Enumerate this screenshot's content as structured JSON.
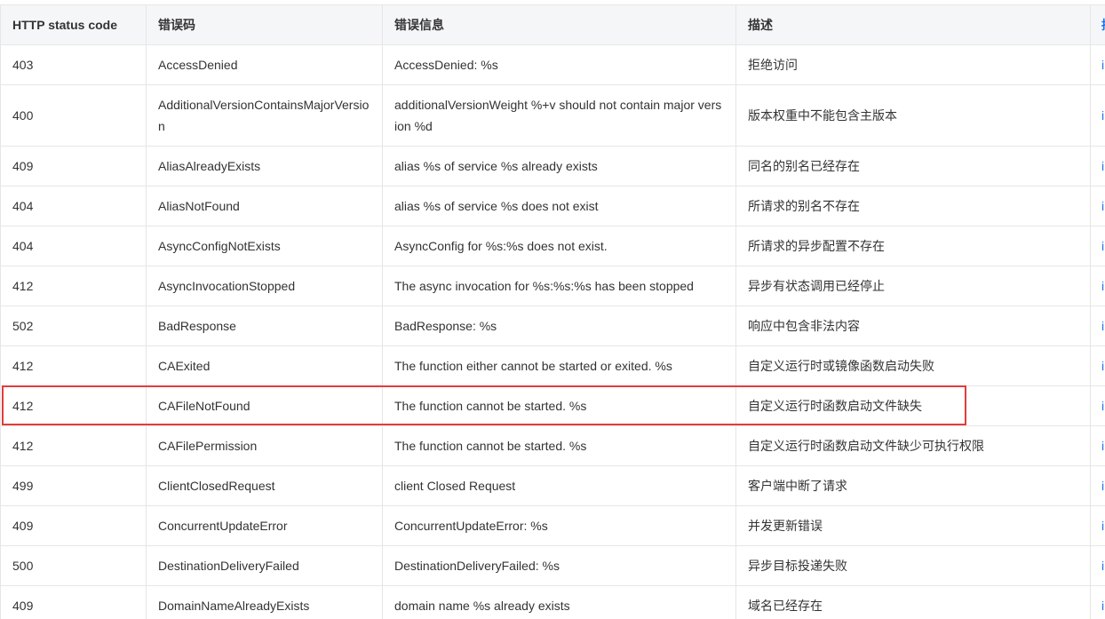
{
  "table": {
    "headers": [
      "HTTP status code",
      "错误码",
      "错误信息",
      "描述",
      "描"
    ],
    "rows": [
      {
        "status": "403",
        "code": "AccessDenied",
        "message": "AccessDenied: %s",
        "desc": "拒绝访问",
        "extra": "i"
      },
      {
        "status": "400",
        "code": "AdditionalVersionContainsMajorVersion",
        "message": "additionalVersionWeight %+v should not contain major version %d",
        "desc": "版本权重中不能包含主版本",
        "extra": "i"
      },
      {
        "status": "409",
        "code": "AliasAlreadyExists",
        "message": "alias %s of service %s already exists",
        "desc": "同名的别名已经存在",
        "extra": "i"
      },
      {
        "status": "404",
        "code": "AliasNotFound",
        "message": "alias %s of service %s does not exist",
        "desc": "所请求的别名不存在",
        "extra": "i"
      },
      {
        "status": "404",
        "code": "AsyncConfigNotExists",
        "message": "AsyncConfig for %s:%s does not exist.",
        "desc": "所请求的异步配置不存在",
        "extra": "i"
      },
      {
        "status": "412",
        "code": "AsyncInvocationStopped",
        "message": "The async invocation for %s:%s:%s has been stopped",
        "desc": "异步有状态调用已经停止",
        "extra": "i"
      },
      {
        "status": "502",
        "code": "BadResponse",
        "message": "BadResponse: %s",
        "desc": "响应中包含非法内容",
        "extra": "i"
      },
      {
        "status": "412",
        "code": "CAExited",
        "message": "The function either cannot be started or exited. %s",
        "desc": "自定义运行时或镜像函数启动失败",
        "extra": "i"
      },
      {
        "status": "412",
        "code": "CAFileNotFound",
        "message": "The function cannot be started. %s",
        "desc": "自定义运行时函数启动文件缺失",
        "extra": "i"
      },
      {
        "status": "412",
        "code": "CAFilePermission",
        "message": "The function cannot be started. %s",
        "desc": "自定义运行时函数启动文件缺少可执行权限",
        "extra": "i"
      },
      {
        "status": "499",
        "code": "ClientClosedRequest",
        "message": "client Closed Request",
        "desc": "客户端中断了请求",
        "extra": "i"
      },
      {
        "status": "409",
        "code": "ConcurrentUpdateError",
        "message": "ConcurrentUpdateError: %s",
        "desc": "并发更新错误",
        "extra": "i"
      },
      {
        "status": "500",
        "code": "DestinationDeliveryFailed",
        "message": "DestinationDeliveryFailed: %s",
        "desc": "异步目标投递失败",
        "extra": "i"
      },
      {
        "status": "409",
        "code": "DomainNameAlreadyExists",
        "message": "domain name %s already exists",
        "desc": "域名已经存在",
        "extra": "i"
      }
    ]
  }
}
